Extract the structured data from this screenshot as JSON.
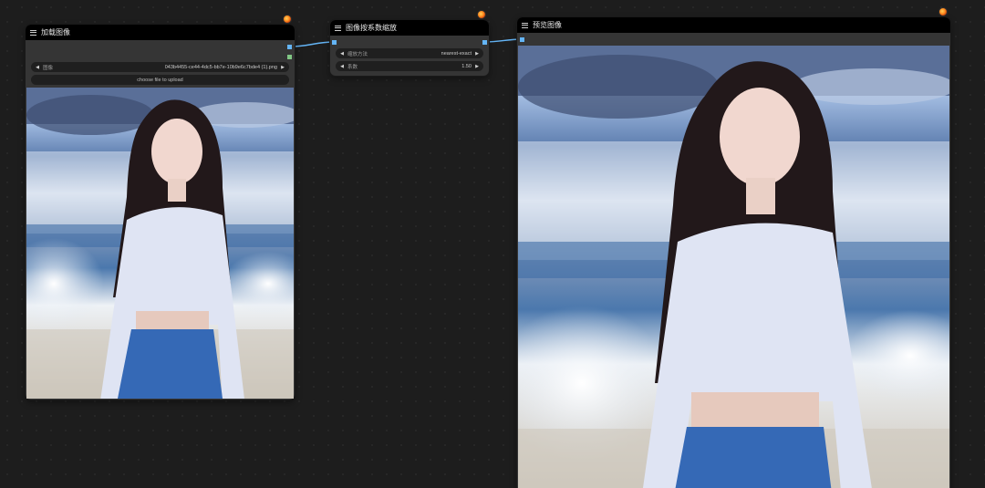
{
  "nodes": {
    "load_image": {
      "title": "加载图像",
      "image_widget": {
        "label": "图像",
        "value": "043b4455-ce44-4dc5-bb7e-10b9e6c7bde4 (1).png"
      },
      "upload_button": "choose file to upload",
      "preview_alt": "photo-of-woman-white-top-blue-skirt"
    },
    "scale_by": {
      "title": "图像按系数缩放",
      "method_widget": {
        "label": "缩放方法",
        "value": "nearest-exact"
      },
      "factor_widget": {
        "label": "系数",
        "value": "1.50"
      }
    },
    "preview_image": {
      "title": "预览图像",
      "preview_alt": "photo-of-woman-white-top-blue-skirt-upscaled"
    }
  },
  "colors": {
    "image_link": "#64b5f6",
    "mask_slot": "#81c784",
    "title_bar": "#000000",
    "node_body": "#353535",
    "canvas": "#1d1d1d"
  },
  "icons": {
    "node_menu": "hamburger-menu-icon",
    "node_badge": "fox-badge-icon",
    "widget_left": "arrow-left-icon",
    "widget_right": "arrow-right-icon"
  }
}
